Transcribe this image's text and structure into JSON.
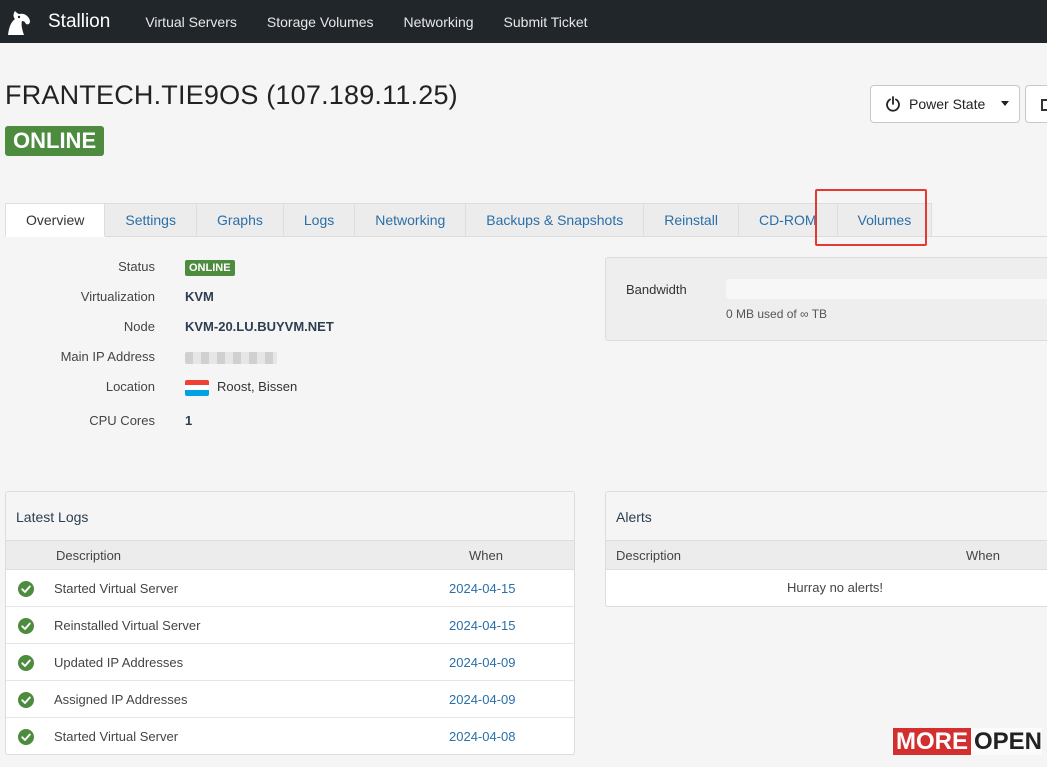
{
  "nav": {
    "brand": "Stallion",
    "items": [
      "Virtual Servers",
      "Storage Volumes",
      "Networking",
      "Submit Ticket"
    ]
  },
  "server": {
    "title": "FRANTECH.TIE9OS (107.189.11.25)",
    "status": "ONLINE"
  },
  "actions": {
    "power_state": "Power State"
  },
  "tabs": [
    "Overview",
    "Settings",
    "Graphs",
    "Logs",
    "Networking",
    "Backups & Snapshots",
    "Reinstall",
    "CD-ROM",
    "Volumes"
  ],
  "details": {
    "status_label": "Status",
    "status_value": "ONLINE",
    "virt_label": "Virtualization",
    "virt_value": "KVM",
    "node_label": "Node",
    "node_value": "KVM-20.LU.BUYVM.NET",
    "ip_label": "Main IP Address",
    "location_label": "Location",
    "location_value": "Roost, Bissen",
    "cpu_label": "CPU Cores",
    "cpu_value": "1"
  },
  "bandwidth": {
    "label": "Bandwidth",
    "used": "0 MB used of ∞ TB"
  },
  "logs": {
    "title": "Latest Logs",
    "col_desc": "Description",
    "col_when": "When",
    "rows": [
      {
        "desc": "Started Virtual Server",
        "when": "2024-04-15"
      },
      {
        "desc": "Reinstalled Virtual Server",
        "when": "2024-04-15"
      },
      {
        "desc": "Updated IP Addresses",
        "when": "2024-04-09"
      },
      {
        "desc": "Assigned IP Addresses",
        "when": "2024-04-09"
      },
      {
        "desc": "Started Virtual Server",
        "when": "2024-04-08"
      }
    ]
  },
  "alerts": {
    "title": "Alerts",
    "col_desc": "Description",
    "col_when": "When",
    "empty": "Hurray no alerts!"
  },
  "watermark": {
    "more": "MORE",
    "open": "OPEN"
  },
  "colors": {
    "navbar": "#21262b",
    "online": "#4d8c3f",
    "link": "#2a6fa8",
    "highlight": "#e53935"
  }
}
